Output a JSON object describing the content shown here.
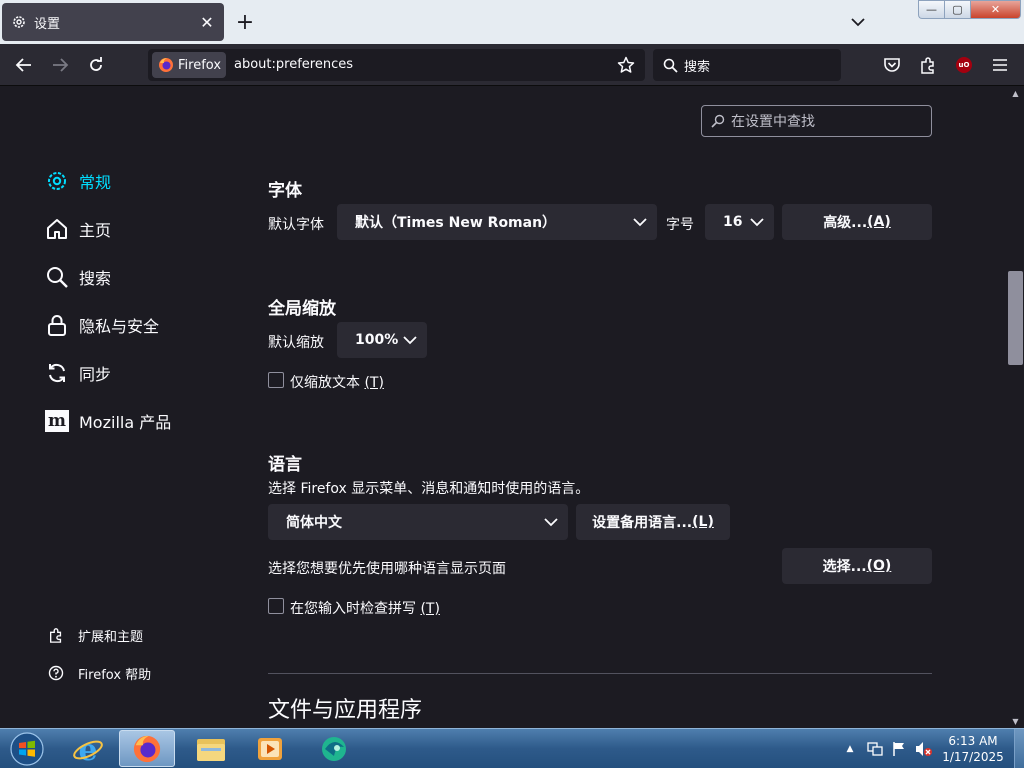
{
  "tab": {
    "title": "设置",
    "icon": "gear-icon"
  },
  "window_controls": {
    "minimize": "—",
    "maximize": "▢",
    "close": "✕"
  },
  "navbar": {
    "identity_label": "Firefox",
    "url": "about:preferences",
    "search_placeholder": "搜索"
  },
  "find_placeholder": "在设置中查找",
  "sidebar": {
    "categories": [
      {
        "label": "常规",
        "icon": "gear-icon",
        "active": true
      },
      {
        "label": "主页",
        "icon": "home-icon"
      },
      {
        "label": "搜索",
        "icon": "search-icon"
      },
      {
        "label": "隐私与安全",
        "icon": "lock-icon"
      },
      {
        "label": "同步",
        "icon": "sync-icon"
      },
      {
        "label": "Mozilla 产品",
        "icon": "mozilla-icon"
      }
    ],
    "footer": [
      {
        "label": "扩展和主题",
        "icon": "puzzle-icon"
      },
      {
        "label": "Firefox 帮助",
        "icon": "help-icon"
      }
    ]
  },
  "fonts": {
    "heading": "字体",
    "default_font_label": "默认字体",
    "default_font_value": "默认（Times New Roman）",
    "size_label": "字号",
    "size_value": "16",
    "advanced_label": "高级... ",
    "advanced_key": "(A)"
  },
  "zoom": {
    "heading": "全局缩放",
    "default_zoom_label": "默认缩放",
    "default_zoom_value": "100%",
    "text_only_label": "仅缩放文本 ",
    "text_only_key": "(T)",
    "text_only_checked": false
  },
  "language": {
    "heading": "语言",
    "description": "选择 Firefox 显示菜单、消息和通知时使用的语言。",
    "ui_language_value": "简体中文",
    "alternatives_label": "设置备用语言... ",
    "alternatives_key": "(L)",
    "page_lang_label": "选择您想要优先使用哪种语言显示页面",
    "choose_label": "选择... ",
    "choose_key": "(O)",
    "spellcheck_label": "在您输入时检查拼写 ",
    "spellcheck_key": "(T)",
    "spellcheck_checked": false
  },
  "files_apps": {
    "heading": "文件与应用程序"
  },
  "taskbar": {
    "apps": [
      "internet-explorer-icon",
      "firefox-icon",
      "file-explorer-icon",
      "media-player-icon",
      "app-icon"
    ],
    "clock_time": "6:13 AM",
    "clock_date": "1/17/2025"
  },
  "colors": {
    "accent": "#00ddff",
    "background": "#1c1b22",
    "button": "#2b2a33"
  }
}
